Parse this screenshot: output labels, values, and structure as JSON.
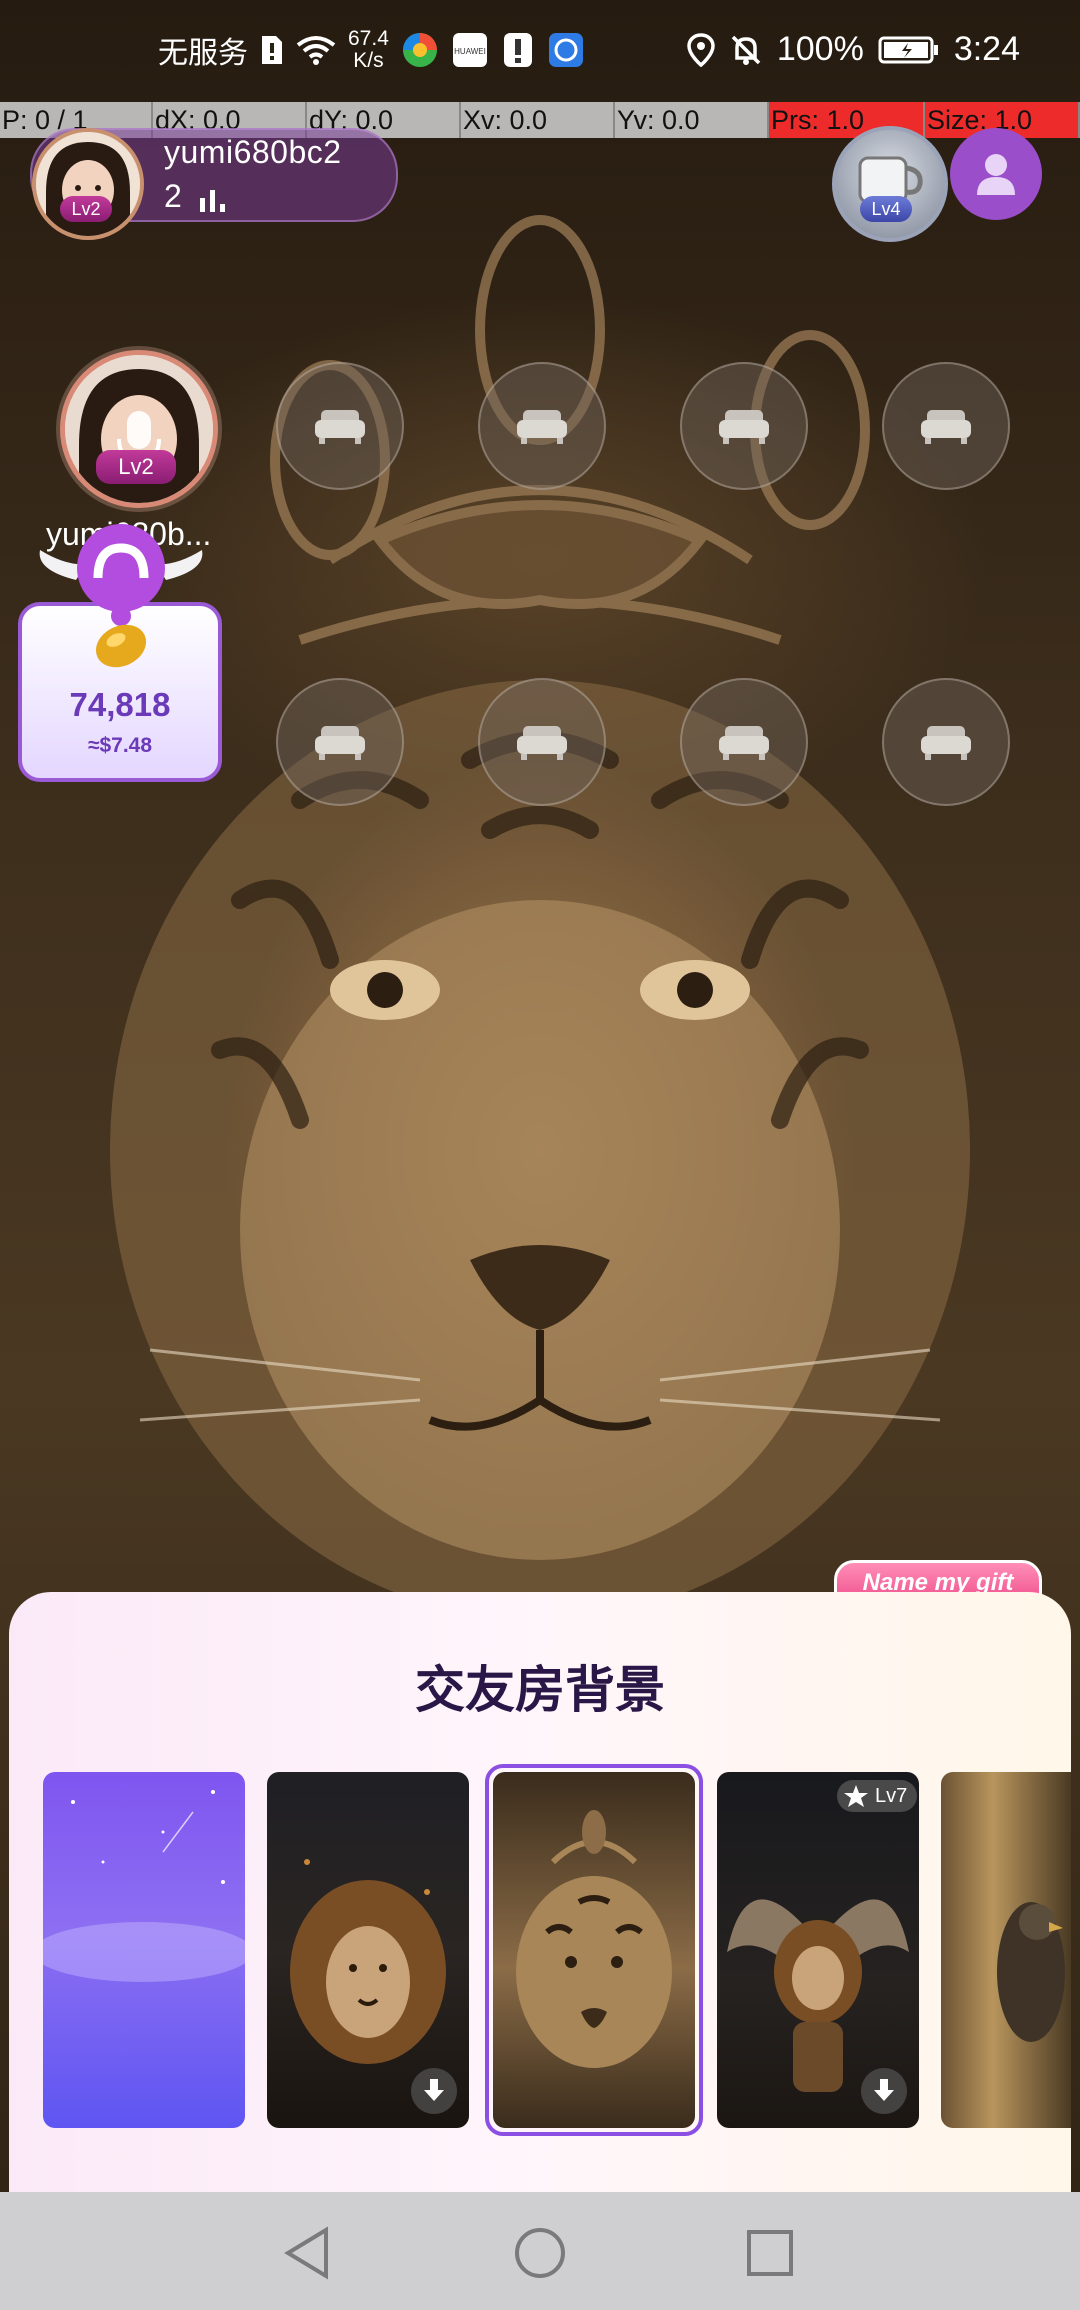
{
  "status_bar": {
    "carrier": "无服务",
    "net_speed_value": "67.4",
    "net_speed_unit": "K/s",
    "vendor_icon_text": "HUAWEI",
    "battery_percent": "100%",
    "time": "3:24"
  },
  "debug_overlay": {
    "pointer": "P: 0 / 1",
    "dx": "dX: 0.0",
    "dy": "dY: 0.0",
    "xv": "Xv: 0.0",
    "yv": "Yv: 0.0",
    "prs": "Prs: 1.0",
    "size": "Size: 1.0"
  },
  "room": {
    "host_name": "yumi680bc2",
    "host_level": "Lv2",
    "online_count": "2",
    "top_right_level": "Lv4"
  },
  "mic_seat": {
    "level": "Lv2",
    "name": "yumi680b..."
  },
  "coin_card": {
    "value": "74,818",
    "usd": "≈$7.48"
  },
  "gift_tag": "Name my gift",
  "sheet": {
    "title": "交友房背景",
    "thumbnails": [
      {
        "name": "purple-starry",
        "badge": ""
      },
      {
        "name": "lion",
        "badge": ""
      },
      {
        "name": "tiger-crown",
        "badge": "",
        "selected": true
      },
      {
        "name": "winged-lion",
        "badge": "Lv7"
      },
      {
        "name": "eagle",
        "badge": ""
      }
    ]
  },
  "colors": {
    "accent": "#8b4fe3",
    "coin_text": "#6b3ab8",
    "sheet_title": "#2a1747",
    "debug_red": "#ee2b2b"
  }
}
